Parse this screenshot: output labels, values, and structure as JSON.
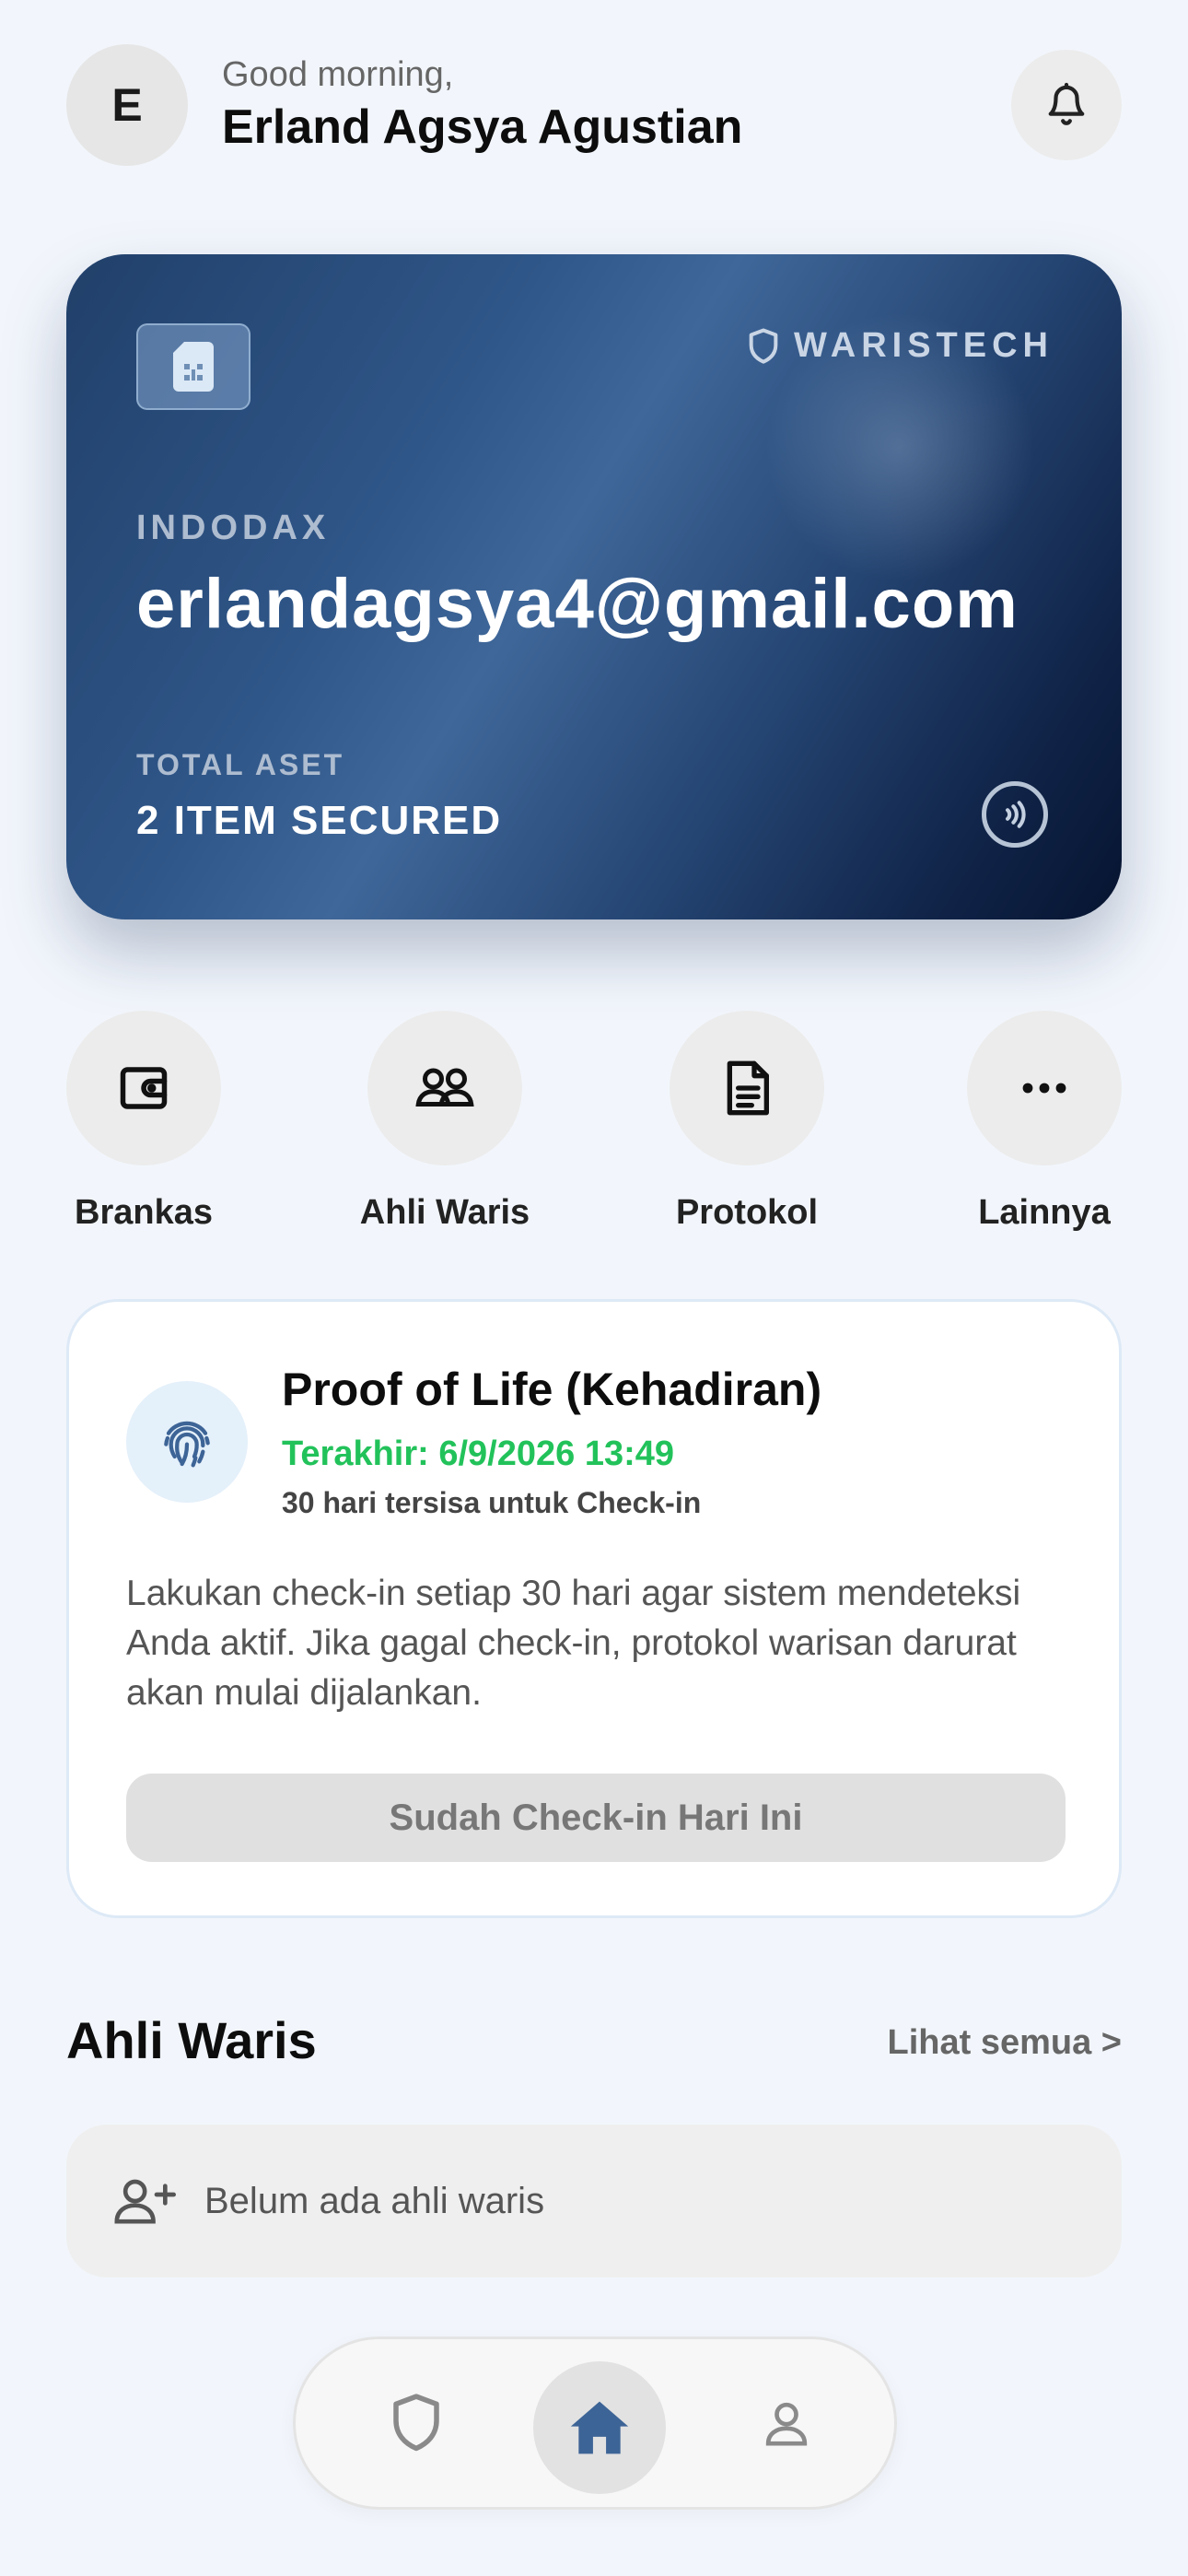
{
  "header": {
    "avatar_initial": "E",
    "greeting": "Good morning,",
    "user_name": "Erland Agsya Agustian",
    "bell_icon": "bell-icon"
  },
  "card": {
    "brand": "WARISTECH",
    "platform": "INDODAX",
    "account": "erlandagsya4@gmail.com",
    "asset_label": "TOTAL ASET",
    "asset_value": "2 ITEM SECURED",
    "icons": [
      "sim-chip-icon",
      "shield-icon",
      "contactless-icon"
    ]
  },
  "actions": [
    {
      "label": "Brankas",
      "icon": "wallet-icon"
    },
    {
      "label": "Ahli Waris",
      "icon": "users-icon"
    },
    {
      "label": "Protokol",
      "icon": "document-icon"
    },
    {
      "label": "Lainnya",
      "icon": "more-icon"
    }
  ],
  "proof_of_life": {
    "title": "Proof of Life (Kehadiran)",
    "last_checkin": "Terakhir: 6/9/2026 13:49",
    "remaining": "30 hari tersisa untuk Check-in",
    "description": "Lakukan check-in setiap 30 hari agar sistem mendeteksi Anda aktif. Jika gagal check-in, protokol warisan darurat akan mulai dijalankan.",
    "button_label": "Sudah Check-in Hari Ini",
    "accent_color": "#22c25a",
    "icon": "fingerprint-icon"
  },
  "heirs": {
    "title": "Ahli Waris",
    "see_all": "Lihat semua >",
    "empty_text": "Belum ada ahli waris",
    "icon": "user-plus-icon"
  },
  "bottom_nav": {
    "items": [
      "shield-icon",
      "home-icon",
      "profile-icon"
    ],
    "active": "home-icon",
    "active_color": "#3d6496"
  }
}
